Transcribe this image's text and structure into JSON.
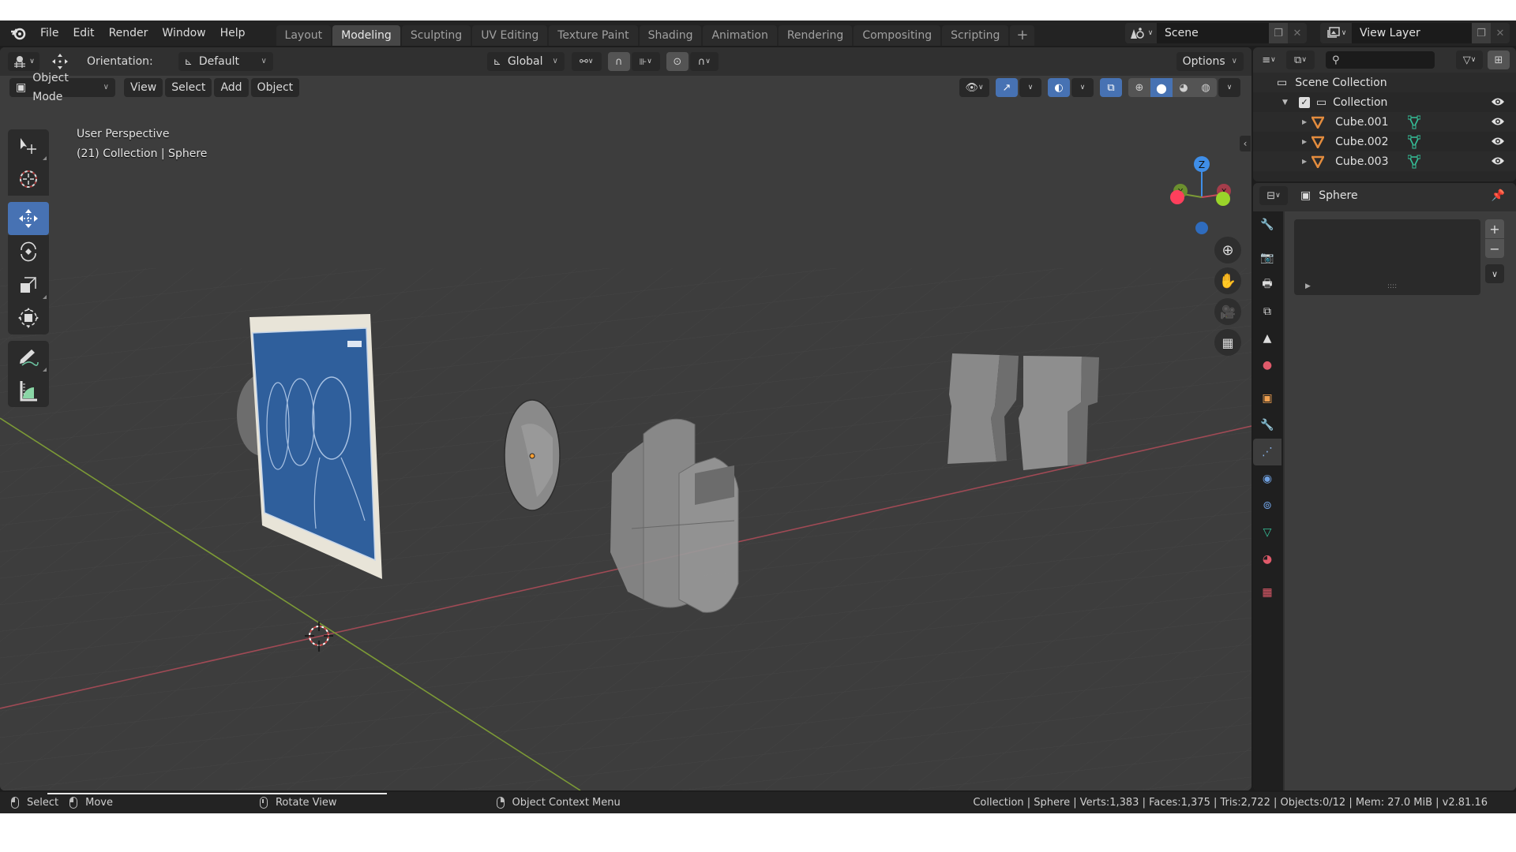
{
  "menubar": {
    "items": [
      "File",
      "Edit",
      "Render",
      "Window",
      "Help"
    ],
    "workspaces": [
      {
        "label": "Layout",
        "active": false
      },
      {
        "label": "Modeling",
        "active": true
      },
      {
        "label": "Sculpting",
        "active": false
      },
      {
        "label": "UV Editing",
        "active": false
      },
      {
        "label": "Texture Paint",
        "active": false
      },
      {
        "label": "Shading",
        "active": false
      },
      {
        "label": "Animation",
        "active": false
      },
      {
        "label": "Rendering",
        "active": false
      },
      {
        "label": "Compositing",
        "active": false
      },
      {
        "label": "Scripting",
        "active": false
      }
    ],
    "add_workspace": "+",
    "scene": "Scene",
    "view_layer": "View Layer"
  },
  "tool_header": {
    "orientation_label": "Orientation:",
    "orientation_value": "Default",
    "transform_orientation": "Global",
    "options_label": "Options"
  },
  "viewport_header": {
    "mode": "Object Mode",
    "menus": [
      "View",
      "Select",
      "Add",
      "Object"
    ],
    "shading_modes": [
      "wireframe",
      "solid",
      "material-preview",
      "rendered"
    ],
    "active_shading": "solid"
  },
  "viewport": {
    "perspective_label": "User Perspective",
    "context_label": "(21) Collection | Sphere",
    "gizmo_axes": {
      "z": "Z",
      "y": "Y",
      "x": "X"
    },
    "colors": {
      "x_axis": "#d8455c",
      "y_axis": "#8bc43f",
      "z_axis": "#3f8ee8",
      "grid": "#474747",
      "background": "#3d3d3d"
    }
  },
  "toolbar": {
    "tools": [
      {
        "name": "select-box",
        "active": false
      },
      {
        "name": "cursor",
        "active": false
      },
      {
        "name": "move",
        "active": true
      },
      {
        "name": "rotate",
        "active": false
      },
      {
        "name": "scale",
        "active": false
      },
      {
        "name": "transform",
        "active": false
      },
      {
        "name": "annotate",
        "active": false
      },
      {
        "name": "measure",
        "active": false
      }
    ]
  },
  "outliner": {
    "root": "Scene Collection",
    "collection": "Collection",
    "items": [
      "Cube.001",
      "Cube.002",
      "Cube.003"
    ]
  },
  "properties": {
    "object_name": "Sphere",
    "tabs": [
      "tool",
      "render",
      "output",
      "view-layer",
      "scene",
      "world",
      "object",
      "modifiers",
      "particles",
      "physics",
      "constraints",
      "data",
      "material",
      "texture"
    ],
    "active_tab": "particles"
  },
  "statusbar": {
    "select": "Select",
    "move": "Move",
    "rotate": "Rotate View",
    "context_menu": "Object Context Menu",
    "stats": "Collection | Sphere | Verts:1,383 | Faces:1,375 | Tris:2,722 | Objects:0/12 | Mem: 27.0 MiB | v2.81.16"
  },
  "accent_color": "#4772b3"
}
